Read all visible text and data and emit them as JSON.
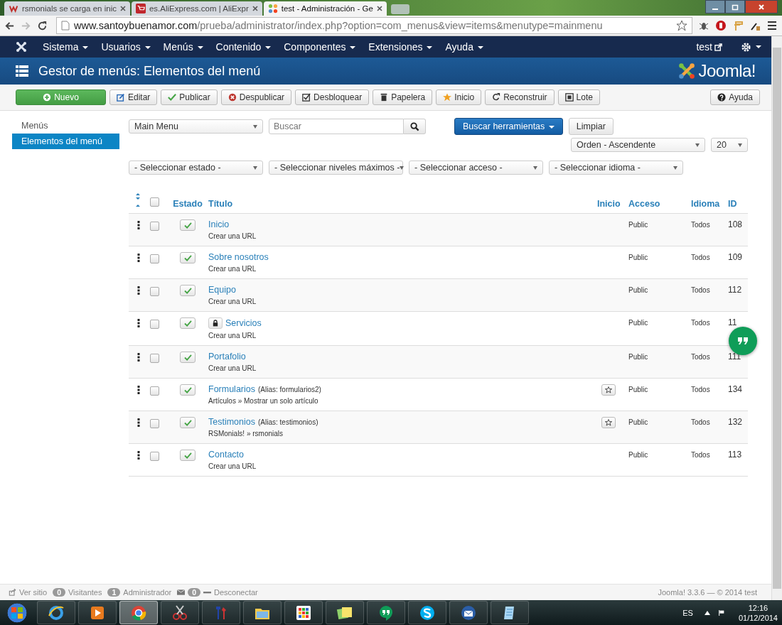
{
  "browser": {
    "tabs": [
      {
        "title": "rsmonials se carga en inic",
        "kind": "rsm",
        "selected": false
      },
      {
        "title": "es.AliExpress.com | AliExpr",
        "kind": "cart",
        "selected": false
      },
      {
        "title": "test - Administración - Ge",
        "kind": "joomla",
        "selected": true
      }
    ],
    "url_host": "www.santoybuenamor.com",
    "url_path": "/prueba/administrator/index.php?option=com_menus&view=items&menutype=mainmenu"
  },
  "admin_menu": [
    "Sistema",
    "Usuarios",
    "Menús",
    "Contenido",
    "Componentes",
    "Extensiones",
    "Ayuda"
  ],
  "user": "test",
  "page_title": "Gestor de menús: Elementos del menú",
  "brand": "Joomla!",
  "toolbar": [
    {
      "label": "Nuevo",
      "kind": "new"
    },
    {
      "label": "Editar",
      "kind": "edit"
    },
    {
      "label": "Publicar",
      "kind": "publish"
    },
    {
      "label": "Despublicar",
      "kind": "unpublish"
    },
    {
      "label": "Desbloquear",
      "kind": "checkin"
    },
    {
      "label": "Papelera",
      "kind": "trash"
    },
    {
      "label": "Inicio",
      "kind": "home"
    },
    {
      "label": "Reconstruir",
      "kind": "rebuild"
    },
    {
      "label": "Lote",
      "kind": "batch"
    }
  ],
  "help_button": "Ayuda",
  "sidebar": [
    {
      "label": "Menús",
      "selected": false
    },
    {
      "label": "Elementos del menú",
      "selected": true
    }
  ],
  "filters": {
    "menu": "Main Menu",
    "search": {
      "placeholder": "Buscar"
    },
    "search_tools": "Buscar herramientas",
    "clear": "Limpiar",
    "ordering": "Orden - Ascendente",
    "limit": "20",
    "selects": [
      "- Seleccionar estado -",
      "- Seleccionar niveles máximos -",
      "- Seleccionar acceso -",
      "- Seleccionar idioma -"
    ]
  },
  "table": {
    "select_all": false,
    "columns": [
      "Estado",
      "Título",
      "Inicio",
      "Acceso",
      "Idioma",
      "ID"
    ],
    "rows": [
      {
        "title": "Inicio",
        "link_type": "Crear una URL",
        "selected": false,
        "published": true,
        "locked": false,
        "home_toggle": false,
        "access": "Public",
        "language": "Todos",
        "id": "108"
      },
      {
        "title": "Sobre nosotros",
        "link_type": "Crear una URL",
        "selected": false,
        "published": true,
        "locked": false,
        "home_toggle": false,
        "access": "Public",
        "language": "Todos",
        "id": "109"
      },
      {
        "title": "Equipo",
        "link_type": "Crear una URL",
        "selected": false,
        "published": true,
        "locked": false,
        "home_toggle": false,
        "access": "Public",
        "language": "Todos",
        "id": "112"
      },
      {
        "title": "Servicios",
        "link_type": "Crear una URL",
        "selected": false,
        "published": true,
        "locked": true,
        "home_toggle": false,
        "access": "Public",
        "language": "Todos",
        "id": "11"
      },
      {
        "title": "Portafolio",
        "link_type": "Crear una URL",
        "selected": false,
        "published": true,
        "locked": false,
        "home_toggle": false,
        "access": "Public",
        "language": "Todos",
        "id": "111"
      },
      {
        "title": "Formularios",
        "alias": "(Alias: formularios2)",
        "link_type": "Artículos » Mostrar un solo artículo",
        "selected": false,
        "published": true,
        "locked": false,
        "home_toggle": true,
        "access": "Public",
        "language": "Todos",
        "id": "134"
      },
      {
        "title": "Testimonios",
        "alias": "(Alias: testimonios)",
        "link_type": "RSMonials! » rsmonials",
        "selected": false,
        "published": true,
        "locked": false,
        "home_toggle": true,
        "access": "Public",
        "language": "Todos",
        "id": "132"
      },
      {
        "title": "Contacto",
        "link_type": "Crear una URL",
        "selected": false,
        "published": true,
        "locked": false,
        "home_toggle": false,
        "access": "Public",
        "language": "Todos",
        "id": "113"
      }
    ]
  },
  "footer": {
    "items": [
      {
        "kind": "link",
        "label": "Ver sitio"
      },
      {
        "kind": "badge",
        "count": "0",
        "label": "Visitantes"
      },
      {
        "kind": "badge",
        "count": "1",
        "label": "Administrador"
      },
      {
        "kind": "mail",
        "count": "0"
      },
      {
        "kind": "logout",
        "label": "Desconectar"
      }
    ],
    "version": "Joomla! 3.3.6 — © 2014 test"
  },
  "taskbar": {
    "apps": [
      {
        "kind": "ie",
        "selected": false
      },
      {
        "kind": "media",
        "selected": false
      },
      {
        "kind": "chrome",
        "selected": true
      },
      {
        "kind": "scissors",
        "selected": false
      },
      {
        "kind": "tools",
        "selected": false
      },
      {
        "kind": "folder",
        "selected": false
      },
      {
        "kind": "grid",
        "selected": false
      },
      {
        "kind": "notes",
        "selected": false
      },
      {
        "kind": "hangouts",
        "selected": false
      },
      {
        "kind": "skype",
        "selected": false
      },
      {
        "kind": "mail",
        "selected": false
      },
      {
        "kind": "notepad",
        "selected": false
      }
    ],
    "lang": "ES",
    "time": "12:16",
    "date": "01/12/2014"
  }
}
